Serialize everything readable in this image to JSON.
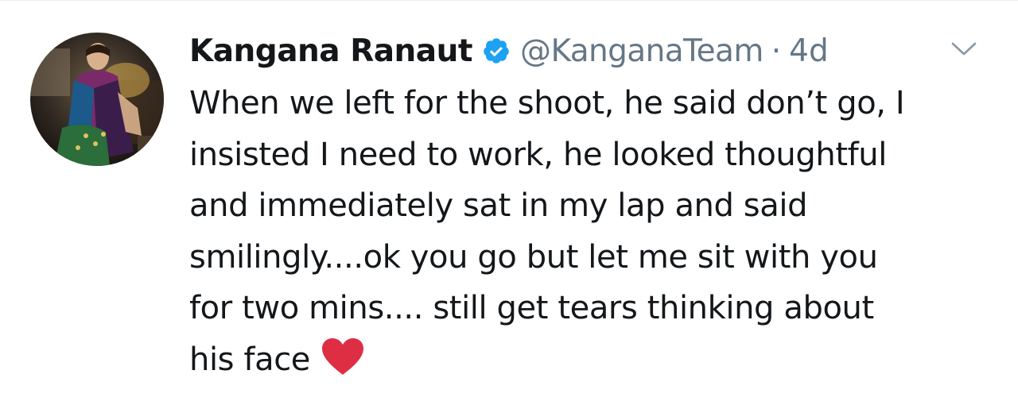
{
  "tweet": {
    "author_name": "Kangana Ranaut",
    "verified_icon": "verified-badge-icon",
    "handle": "@KanganaTeam",
    "separator": "·",
    "timestamp": "4d",
    "menu_icon": "chevron-down-icon",
    "text_lines": [
      "When we left for the shoot, he said don’t go, I",
      "insisted I need to work, he looked thoughtful",
      "and immediately sat in my lap and said",
      "smilingly....ok you go but let me sit with you",
      "for two mins.... still get tears thinking about",
      "his face"
    ],
    "emoji": "heart-emoji-icon"
  },
  "colors": {
    "text": "#14171a",
    "secondary": "#657786",
    "verified": "#1da1f2",
    "heart": "#dd2e44"
  }
}
